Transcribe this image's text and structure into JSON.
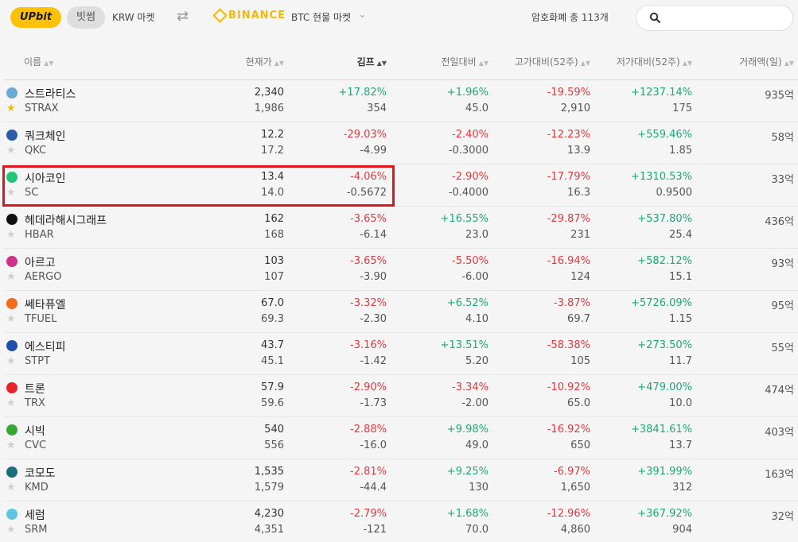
{
  "topbar": {
    "logo": "UPbit",
    "bitsum": "빗썸",
    "krw_market": "KRW 마켓",
    "binance": "BINANCE",
    "btc_market": "BTC 현물 마켓",
    "coin_count": "암호화폐 총 113개",
    "search_placeholder": ""
  },
  "header": {
    "name": "이름",
    "price": "현재가",
    "gimp": "김프",
    "day": "전일대비",
    "high": "고가대비(52주)",
    "low": "저가대비(52주)",
    "volume": "거래액(일)"
  },
  "colors": {
    "up": "#1ba97b",
    "down": "#e0393e",
    "highlight": "#e2141b",
    "upbit": "#ffc107",
    "binance": "#f0b90b"
  },
  "rows": [
    {
      "name": "스트라티스",
      "symbol": "STRAX",
      "icon": "strax-icon",
      "icon_color": "#6aa8d6",
      "fav": true,
      "price": "2,340",
      "price2": "1,986",
      "gimp": "+17.82%",
      "gimp2": "354",
      "gimp_dir": "up",
      "day": "+1.96%",
      "day2": "45.0",
      "day_dir": "up",
      "high": "-19.59%",
      "high2": "2,910",
      "high_dir": "down",
      "low": "+1237.14%",
      "low2": "175",
      "low_dir": "up",
      "vol": "935억"
    },
    {
      "name": "쿼크체인",
      "symbol": "QKC",
      "icon": "qkc-icon",
      "icon_color": "#2a5ca8",
      "fav": false,
      "price": "12.2",
      "price2": "17.2",
      "gimp": "-29.03%",
      "gimp2": "-4.99",
      "gimp_dir": "down",
      "day": "-2.40%",
      "day2": "-0.3000",
      "day_dir": "down",
      "high": "-12.23%",
      "high2": "13.9",
      "high_dir": "down",
      "low": "+559.46%",
      "low2": "1.85",
      "low_dir": "up",
      "vol": "58억"
    },
    {
      "name": "시아코인",
      "symbol": "SC",
      "icon": "sc-icon",
      "icon_color": "#20c67a",
      "fav": false,
      "price": "13.4",
      "price2": "14.0",
      "gimp": "-4.06%",
      "gimp2": "-0.5672",
      "gimp_dir": "down",
      "day": "-2.90%",
      "day2": "-0.4000",
      "day_dir": "down",
      "high": "-17.79%",
      "high2": "16.3",
      "high_dir": "down",
      "low": "+1310.53%",
      "low2": "0.9500",
      "low_dir": "up",
      "vol": "33억"
    },
    {
      "name": "헤데라해시그래프",
      "symbol": "HBAR",
      "icon": "hbar-icon",
      "icon_color": "#111111",
      "fav": false,
      "price": "162",
      "price2": "168",
      "gimp": "-3.65%",
      "gimp2": "-6.14",
      "gimp_dir": "down",
      "day": "+16.55%",
      "day2": "23.0",
      "day_dir": "up",
      "high": "-29.87%",
      "high2": "231",
      "high_dir": "down",
      "low": "+537.80%",
      "low2": "25.4",
      "low_dir": "up",
      "vol": "436억"
    },
    {
      "name": "아르고",
      "symbol": "AERGO",
      "icon": "aergo-icon",
      "icon_color": "#d0308a",
      "fav": false,
      "price": "103",
      "price2": "107",
      "gimp": "-3.65%",
      "gimp2": "-3.90",
      "gimp_dir": "down",
      "day": "-5.50%",
      "day2": "-6.00",
      "day_dir": "down",
      "high": "-16.94%",
      "high2": "124",
      "high_dir": "down",
      "low": "+582.12%",
      "low2": "15.1",
      "low_dir": "up",
      "vol": "93억"
    },
    {
      "name": "쎄타퓨엘",
      "symbol": "TFUEL",
      "icon": "tfuel-icon",
      "icon_color": "#f26b1d",
      "fav": false,
      "price": "67.0",
      "price2": "69.3",
      "gimp": "-3.32%",
      "gimp2": "-2.30",
      "gimp_dir": "down",
      "day": "+6.52%",
      "day2": "4.10",
      "day_dir": "up",
      "high": "-3.87%",
      "high2": "69.7",
      "high_dir": "down",
      "low": "+5726.09%",
      "low2": "1.15",
      "low_dir": "up",
      "vol": "95억"
    },
    {
      "name": "에스티피",
      "symbol": "STPT",
      "icon": "stpt-icon",
      "icon_color": "#1f4fa8",
      "fav": false,
      "price": "43.7",
      "price2": "45.1",
      "gimp": "-3.16%",
      "gimp2": "-1.42",
      "gimp_dir": "down",
      "day": "+13.51%",
      "day2": "5.20",
      "day_dir": "up",
      "high": "-58.38%",
      "high2": "105",
      "high_dir": "down",
      "low": "+273.50%",
      "low2": "11.7",
      "low_dir": "up",
      "vol": "55억"
    },
    {
      "name": "트론",
      "symbol": "TRX",
      "icon": "trx-icon",
      "icon_color": "#e5242b",
      "fav": false,
      "price": "57.9",
      "price2": "59.6",
      "gimp": "-2.90%",
      "gimp2": "-1.73",
      "gimp_dir": "down",
      "day": "-3.34%",
      "day2": "-2.00",
      "day_dir": "down",
      "high": "-10.92%",
      "high2": "65.0",
      "high_dir": "down",
      "low": "+479.00%",
      "low2": "10.0",
      "low_dir": "up",
      "vol": "474억"
    },
    {
      "name": "시빅",
      "symbol": "CVC",
      "icon": "cvc-icon",
      "icon_color": "#3aa636",
      "fav": false,
      "price": "540",
      "price2": "556",
      "gimp": "-2.88%",
      "gimp2": "-16.0",
      "gimp_dir": "down",
      "day": "+9.98%",
      "day2": "49.0",
      "day_dir": "up",
      "high": "-16.92%",
      "high2": "650",
      "high_dir": "down",
      "low": "+3841.61%",
      "low2": "13.7",
      "low_dir": "up",
      "vol": "403억"
    },
    {
      "name": "코모도",
      "symbol": "KMD",
      "icon": "kmd-icon",
      "icon_color": "#1a6e7e",
      "fav": false,
      "price": "1,535",
      "price2": "1,579",
      "gimp": "-2.81%",
      "gimp2": "-44.4",
      "gimp_dir": "down",
      "day": "+9.25%",
      "day2": "130",
      "day_dir": "up",
      "high": "-6.97%",
      "high2": "1,650",
      "high_dir": "down",
      "low": "+391.99%",
      "low2": "312",
      "low_dir": "up",
      "vol": "163억"
    },
    {
      "name": "세럼",
      "symbol": "SRM",
      "icon": "srm-icon",
      "icon_color": "#5ec6e0",
      "fav": false,
      "price": "4,230",
      "price2": "4,351",
      "gimp": "-2.79%",
      "gimp2": "-121",
      "gimp_dir": "down",
      "day": "+1.68%",
      "day2": "70.0",
      "day_dir": "up",
      "high": "-12.96%",
      "high2": "4,860",
      "high_dir": "down",
      "low": "+367.92%",
      "low2": "904",
      "low_dir": "up",
      "vol": "32억"
    }
  ]
}
